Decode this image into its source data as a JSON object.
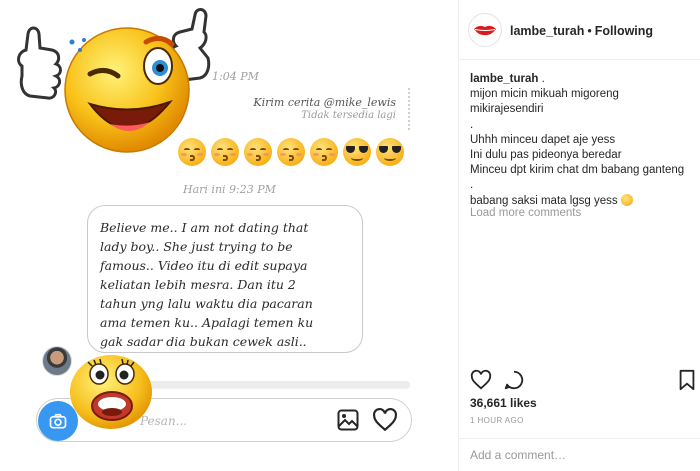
{
  "post_image": {
    "time_top": "1:04 PM",
    "story_title": "Kirim cerita @mike_lewis",
    "story_subtitle": "Tidak tersedia lagi",
    "time_mid": "Hari ini 9:23 PM",
    "message": "Believe me.. I am not dating that\nlady boy.. She just trying to be\nfamous.. Video itu di edit supaya\nkeliatan lebih  mesra. Dan itu 2\ntahun yng lalu waktu dia pacaran\nama temen ku.. Apalagi temen ku\ngak sadar dia bukan cewek asli..",
    "composer_placeholder": "Pesan...",
    "emoji_row": [
      "kissing-face-icon",
      "kissing-face-icon",
      "kissing-face-icon",
      "kissing-face-icon",
      "kissing-face-icon",
      "sunglasses-face-icon",
      "sunglasses-face-icon"
    ]
  },
  "header": {
    "username": "lambe_turah",
    "separator": "•",
    "follow_status": "Following"
  },
  "caption": {
    "username": "lambe_turah",
    "first_line_rest": " .",
    "lines": [
      "mijon micin mikuah migoreng",
      "mikirajesendiri",
      ".",
      "Uhhh minceu dapet aje yess",
      "Ini dulu pas pideonya beredar",
      "Minceu dpt kirim chat dm babang ganteng",
      ".",
      "babang saksi mata lgsg yess"
    ]
  },
  "load_more": "Load more comments",
  "likes": "36,661 likes",
  "timestamp": "1 HOUR AGO",
  "comment_placeholder": "Add a comment…",
  "colors": {
    "accent_blue": "#3897f0",
    "text": "#262626",
    "muted": "#999999",
    "border": "#efefef"
  }
}
